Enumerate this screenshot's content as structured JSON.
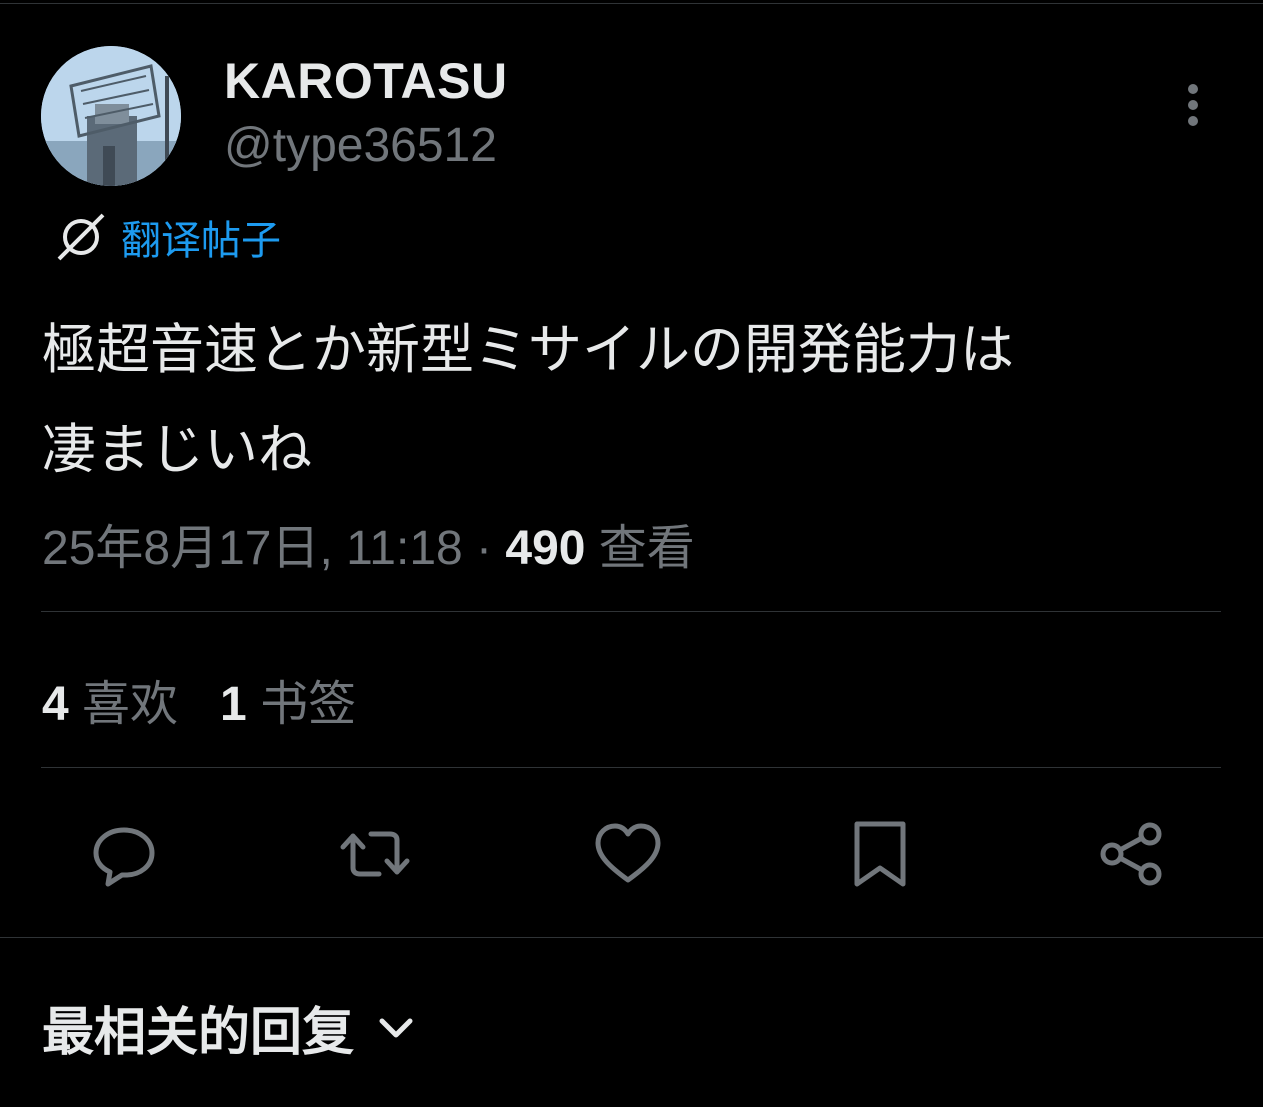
{
  "post": {
    "author": {
      "display_name": "KAROTASU",
      "handle": "@type36512"
    },
    "translate_label": "翻译帖子",
    "text_line1": "極超音速とか新型ミサイルの開発能力は",
    "text_line2": "凄まじいね",
    "timestamp": "25年8月17日, 11:18",
    "separator": " · ",
    "views_count": "490",
    "views_label": " 查看"
  },
  "stats": {
    "likes_count": "4",
    "likes_label": " 喜欢",
    "bookmarks_count": "1",
    "bookmarks_label": " 书签"
  },
  "actions": [
    "reply-icon",
    "repost-icon",
    "like-icon",
    "bookmark-icon",
    "share-icon"
  ],
  "replies": {
    "sort_label": "最相关的回复"
  },
  "colors": {
    "background": "#000000",
    "text_primary": "#e7e9ea",
    "text_secondary": "#71767b",
    "accent": "#1d9bf0",
    "divider": "#2f3336"
  }
}
